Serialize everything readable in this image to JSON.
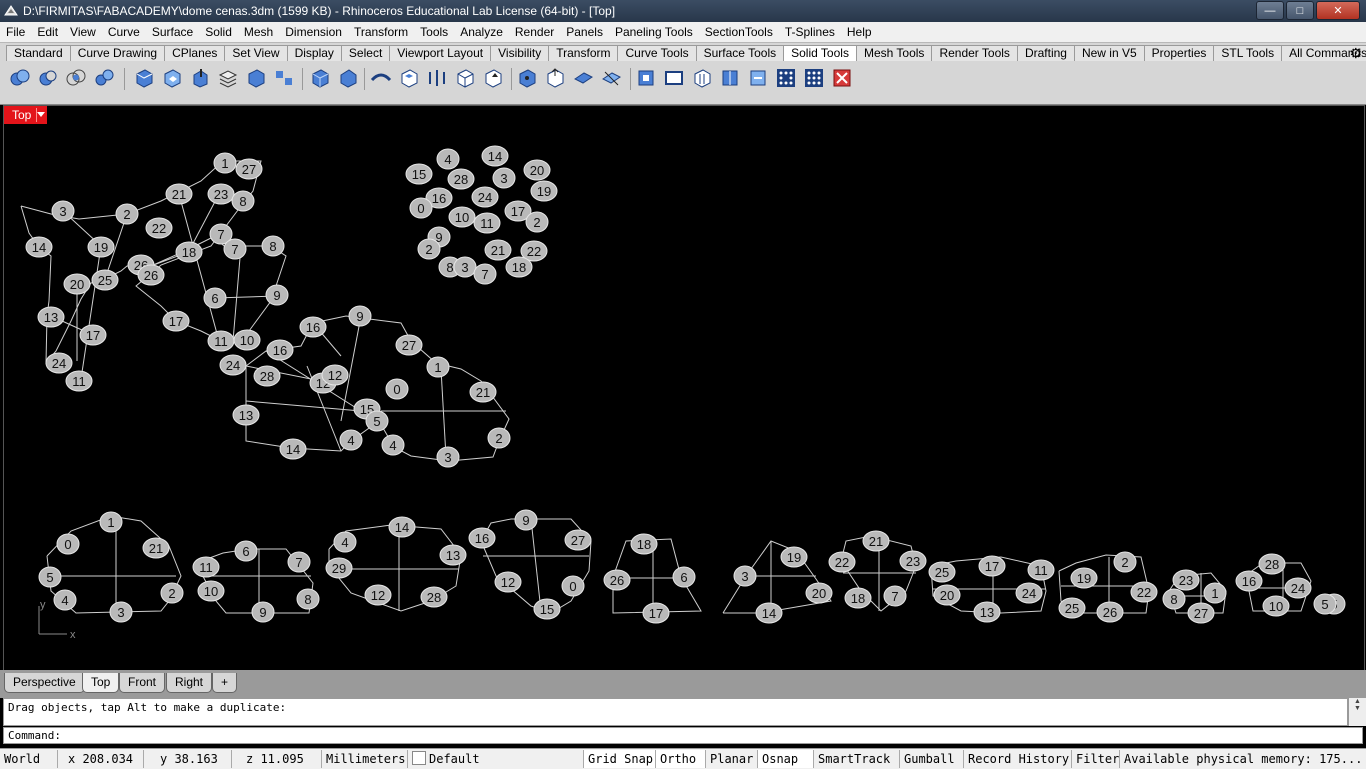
{
  "window": {
    "title": "D:\\FIRMITAS\\FABACADEMY\\dome cenas.3dm (1599 KB) - Rhinoceros Educational Lab License (64-bit) - [Top]",
    "minimize": "—",
    "maximize": "□",
    "close": "✕"
  },
  "menu": [
    "File",
    "Edit",
    "View",
    "Curve",
    "Surface",
    "Solid",
    "Mesh",
    "Dimension",
    "Transform",
    "Tools",
    "Analyze",
    "Render",
    "Panels",
    "Paneling Tools",
    "SectionTools",
    "T-Splines",
    "Help"
  ],
  "toolbar_tabs": [
    "Standard",
    "Curve Drawing",
    "CPlanes",
    "Set View",
    "Display",
    "Select",
    "Viewport Layout",
    "Visibility",
    "Transform",
    "Curve Tools",
    "Surface Tools",
    "Solid Tools",
    "Mesh Tools",
    "Render Tools",
    "Drafting",
    "New in V5",
    "Properties",
    "STL Tools",
    "All Commands"
  ],
  "active_tab": "Solid Tools",
  "viewport": {
    "label": "Top",
    "axis_x": "x",
    "axis_y": "y"
  },
  "view_tabs": [
    "Perspective",
    "Top",
    "Front",
    "Right",
    "+"
  ],
  "history": {
    "line1": "Drag objects, tap Alt to make a duplicate:"
  },
  "command": {
    "prompt": "Command:"
  },
  "status": {
    "cplane": "World",
    "x": "x 208.034",
    "y": "y 38.163",
    "z": "z 11.095",
    "units": "Millimeters",
    "layer": "Default",
    "grid_snap": "Grid Snap",
    "ortho": "Ortho",
    "planar": "Planar",
    "osnap": "Osnap",
    "smarttrack": "SmartTrack",
    "gumball": "Gumball",
    "record_history": "Record History",
    "filter": "Filter",
    "memory": "Available physical memory: 175..."
  },
  "colors": {
    "label_fill": "#b9b9b9",
    "wire": "#cfcfcf",
    "viewport_label": "#e3141a"
  },
  "groups": [
    {
      "labels": [
        "1",
        "27",
        "21",
        "23",
        "8",
        "3",
        "2",
        "22",
        "14",
        "19",
        "7",
        "7",
        "18",
        "8",
        "26",
        "26",
        "20",
        "25",
        "6",
        "9",
        "13",
        "17",
        "17",
        "11",
        "10",
        "24",
        "11"
      ]
    },
    {
      "labels": [
        "4",
        "14",
        "20",
        "15",
        "28",
        "3",
        "19",
        "16",
        "24",
        "0",
        "10",
        "11",
        "17",
        "2",
        "9",
        "21",
        "22",
        "2",
        "8",
        "3",
        "7",
        "18"
      ]
    },
    {
      "labels": [
        "16",
        "9",
        "27",
        "1",
        "16",
        "24",
        "28",
        "12",
        "12",
        "0",
        "21",
        "13",
        "15",
        "5",
        "4",
        "4",
        "2",
        "14",
        "3"
      ]
    },
    {
      "labels": [
        "1",
        "0",
        "21",
        "5",
        "4",
        "3",
        "2"
      ]
    },
    {
      "labels": [
        "6",
        "11",
        "7",
        "10",
        "9",
        "8"
      ]
    },
    {
      "labels": [
        "14",
        "4",
        "13",
        "29",
        "12",
        "28"
      ]
    },
    {
      "labels": [
        "9",
        "16",
        "27",
        "12",
        "0",
        "15"
      ]
    },
    {
      "labels": [
        "18",
        "26",
        "6",
        "17"
      ]
    },
    {
      "labels": [
        "19",
        "3",
        "20",
        "14"
      ]
    },
    {
      "labels": [
        "21",
        "22",
        "23",
        "18",
        "7"
      ]
    },
    {
      "labels": [
        "17",
        "25",
        "11",
        "20",
        "24",
        "13"
      ]
    },
    {
      "labels": [
        "2",
        "19",
        "22",
        "25",
        "26"
      ]
    },
    {
      "labels": [
        "23",
        "8",
        "1",
        "27"
      ]
    },
    {
      "labels": [
        "28",
        "16",
        "24",
        "10",
        "5",
        "5"
      ]
    }
  ]
}
